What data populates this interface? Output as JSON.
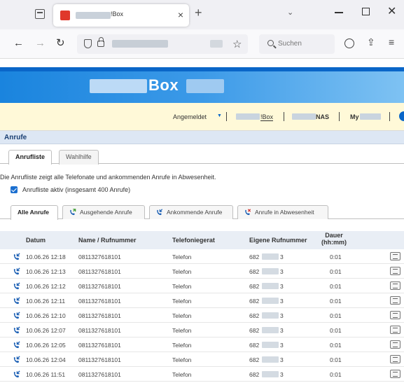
{
  "browser": {
    "tab_title": "!Box",
    "tab_close": "×",
    "new_tab": "+",
    "tab_list_dropdown": "⌄",
    "window_close": "✕",
    "search_placeholder": "Suchen",
    "icons": {
      "back": "back-arrow-icon",
      "forward": "forward-arrow-icon",
      "reload": "reload-icon",
      "bookmark": "star-icon",
      "share": "share-icon",
      "extensions": "extensions-icon"
    }
  },
  "header": {
    "logo_text": "Box",
    "user_menu_label": "Angemeldet",
    "user_menu_caret": "▼",
    "separator": "|",
    "link_box": "!Box",
    "link_nas": "NAS",
    "link_my": "My"
  },
  "section": {
    "title": "Anrufe"
  },
  "subtabs": [
    {
      "label": "Anrufliste",
      "active": true
    },
    {
      "label": "Wahlhilfe",
      "active": false
    }
  ],
  "description": "Die Anrufliste zeigt alle Telefonate und ankommenden Anrufe in Abwesenheit.",
  "checkbox": {
    "label": "Anrufliste aktiv (insgesamt 400 Anrufe)",
    "checked": true
  },
  "filter_tabs": [
    {
      "label": "Alle Anrufe",
      "active": true,
      "icon": ""
    },
    {
      "label": "Ausgehende Anrufe",
      "active": false,
      "icon": "outgoing-call-icon"
    },
    {
      "label": "Ankommende Anrufe",
      "active": false,
      "icon": "incoming-call-icon"
    },
    {
      "label": "Anrufe in Abwesenheit",
      "active": false,
      "icon": "missed-call-icon"
    }
  ],
  "table": {
    "headers": {
      "datum": "Datum",
      "name": "Name / Rufnummer",
      "telefoniegeraet": "Telefoniegerat",
      "eigene": "Eigene Rufnummer",
      "dauer_line1": "Dauer",
      "dauer_line2": "(hh:mm)"
    },
    "rows": [
      {
        "datum": "10.06.26 12:18",
        "name": "081132761810​1",
        "geraet": "Telefon",
        "eigene_prefix": "682",
        "eigene_suffix": "3",
        "dauer": "0:01"
      },
      {
        "datum": "10.06.26 12:13",
        "name": "081132761810​1",
        "geraet": "Telefon",
        "eigene_prefix": "682",
        "eigene_suffix": "3",
        "dauer": "0:01"
      },
      {
        "datum": "10.06.26 12:12",
        "name": "081132761810​1",
        "geraet": "Telefon",
        "eigene_prefix": "682",
        "eigene_suffix": "3",
        "dauer": "0:01"
      },
      {
        "datum": "10.06.26 12:11",
        "name": "081132761810​1",
        "geraet": "Telefon",
        "eigene_prefix": "682",
        "eigene_suffix": "3",
        "dauer": "0:01"
      },
      {
        "datum": "10.06.26 12:10",
        "name": "081132761810​1",
        "geraet": "Telefon",
        "eigene_prefix": "682",
        "eigene_suffix": "3",
        "dauer": "0:01"
      },
      {
        "datum": "10.06.26 12:07",
        "name": "081132761810​1",
        "geraet": "Telefon",
        "eigene_prefix": "682",
        "eigene_suffix": "3",
        "dauer": "0:01"
      },
      {
        "datum": "10.06.26 12:05",
        "name": "081132761810​1",
        "geraet": "Telefon",
        "eigene_prefix": "682",
        "eigene_suffix": "3",
        "dauer": "0:01"
      },
      {
        "datum": "10.06.26 12:04",
        "name": "081132761810​1",
        "geraet": "Telefon",
        "eigene_prefix": "682",
        "eigene_suffix": "3",
        "dauer": "0:01"
      },
      {
        "datum": "10.06.26 11:51",
        "name": "081132761810​1",
        "geraet": "Telefon",
        "eigene_prefix": "682",
        "eigene_suffix": "3",
        "dauer": "0:01"
      }
    ]
  },
  "colors": {
    "brand_blue": "#0a66c8",
    "section_bg": "#dde7f4",
    "userbar_bg": "#fff9d8",
    "call_icon_blue": "#1b5fb4",
    "outgoing_green": "#3a9b2c",
    "missed_red": "#d4302a"
  }
}
